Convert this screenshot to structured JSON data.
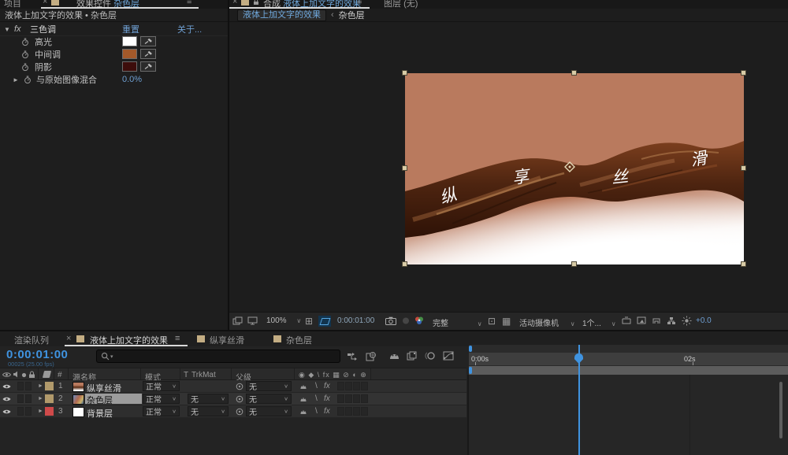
{
  "icons": {
    "menu": "≡",
    "close": "×",
    "chevron": "∨",
    "crumb_sep": "‹",
    "expander_open": "▼",
    "expander_closed": "►",
    "search_caret": "▾",
    "fx": "fx",
    "switch_header": "◉ ◆ \\ fx ▦ ⊘ ◐ ⊕",
    "quality": "\\",
    "grid_options": "⊞",
    "region_of_interest": "⊡",
    "pixel_aspect": "▦",
    "bullet": "•"
  },
  "colors": {
    "accent": "#3f93e0",
    "highlight_swatch": "#ffffff",
    "midtone_swatch": "#a3592a",
    "shadow_swatch": "#3d0d0b",
    "label_tan": "#b19a6b",
    "label_red": "#cf4a4a",
    "bar1": "#6e6251",
    "bar2": "#a89a76",
    "bar3": "#87413c",
    "canvas_bg": "#b97a5e"
  },
  "effect_panel": {
    "tab_project": "项目",
    "tab_active": "效果控件",
    "tab_active_target": "杂色层",
    "breadcrumb": "液体上加文字的效果 • 杂色层",
    "effect_name": "三色调",
    "reset": "重置",
    "about": "关于...",
    "props": [
      {
        "label": "高光"
      },
      {
        "label": "中间调"
      },
      {
        "label": "阴影"
      },
      {
        "label": "与原始图像混合",
        "value": "0.0%"
      }
    ]
  },
  "viewer": {
    "tab_comp_label": "合成",
    "tab_comp_name": "液体上加文字的效果",
    "tab_layer": "图层",
    "tab_layer_value": "(无)",
    "crumb_comp": "液体上加文字的效果",
    "crumb_layer": "杂色层",
    "canvas_chars": [
      "纵",
      "享",
      "丝",
      "滑"
    ],
    "toolbar": {
      "zoom": "100%",
      "timecode": "0:00:01:00",
      "resolution": "完整",
      "camera": "活动摄像机",
      "views": "1个...",
      "exposure": "+0.0"
    }
  },
  "timeline": {
    "tab_render_queue": "渲染队列",
    "tabs": [
      {
        "label": "液体上加文字的效果"
      },
      {
        "label": "纵享丝滑"
      },
      {
        "label": "杂色层"
      }
    ],
    "timecode": "0:00:01:00",
    "frame_info": "00025 (25.00 fps)",
    "columns": {
      "index": "#",
      "source_name": "源名称",
      "mode": "模式",
      "t": "T",
      "trkmat": "TrkMat",
      "parent": "父级"
    },
    "ruler": {
      "start": "0:00s",
      "two": "02s"
    },
    "layers": [
      {
        "num": "1",
        "name": "纵享丝滑",
        "mode": "正常",
        "trkmat": "",
        "parent": "无"
      },
      {
        "num": "2",
        "name": "杂色层",
        "mode": "正常",
        "trkmat": "无",
        "parent": "无"
      },
      {
        "num": "3",
        "name": "背景层",
        "mode": "正常",
        "trkmat": "无",
        "parent": "无"
      }
    ]
  }
}
